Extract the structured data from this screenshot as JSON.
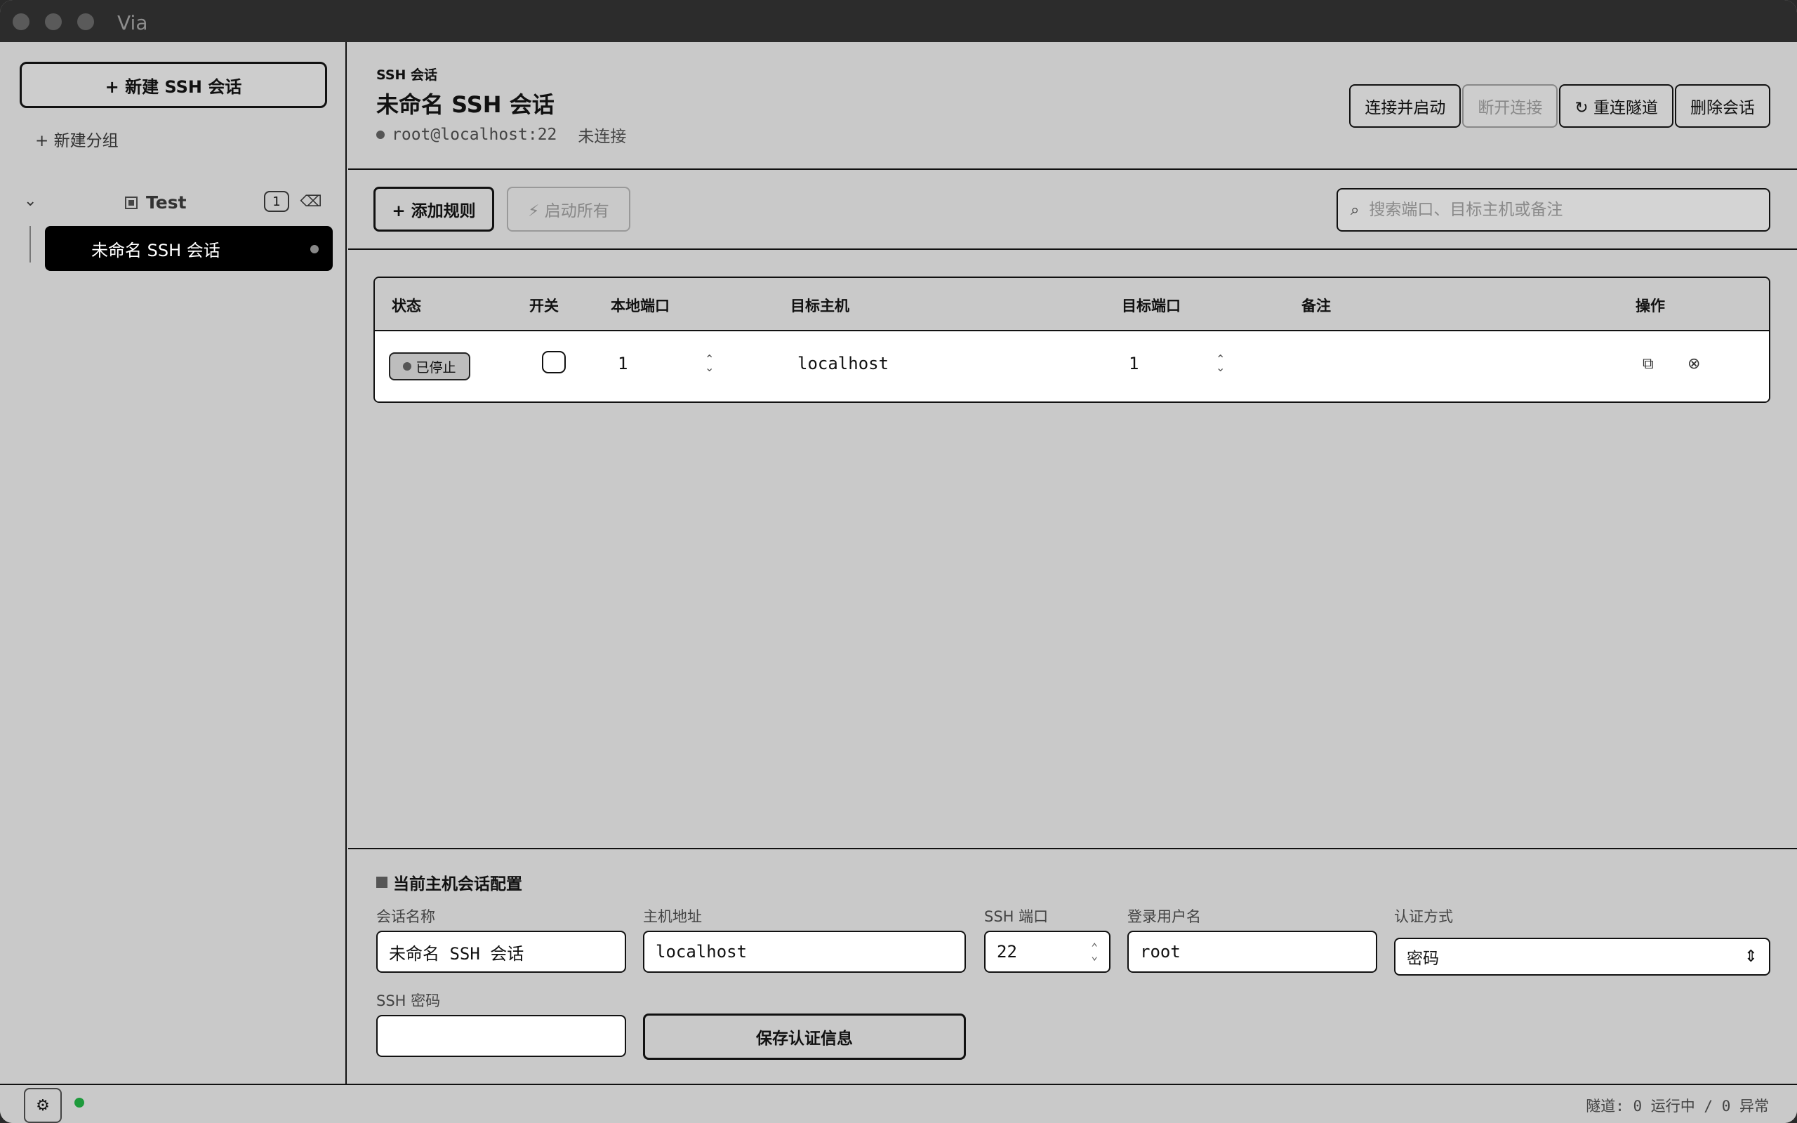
{
  "window": {
    "title": "Via"
  },
  "sidebar": {
    "new_session_label": "+ 新建 SSH 会话",
    "new_group_label": "+ 新建分组",
    "group": {
      "name": "Test",
      "count": "1"
    },
    "session": {
      "name": "未命名 SSH 会话"
    }
  },
  "header": {
    "kicker": "SSH 会话",
    "title": "未命名 SSH 会话",
    "target": "root@localhost:22",
    "connection_status": "未连接",
    "actions": {
      "connect": "连接并启动",
      "disconnect": "断开连接",
      "reconnect": "↻ 重连隧道",
      "delete": "删除会话"
    }
  },
  "toolbar": {
    "add_rule": "+ 添加规则",
    "start_all": "⚡ 启动所有",
    "search_placeholder": "搜索端口、目标主机或备注"
  },
  "rules": {
    "columns": [
      "状态",
      "开关",
      "本地端口",
      "目标主机",
      "目标端口",
      "备注",
      "操作"
    ],
    "rows": [
      {
        "status": "已停止",
        "enabled": false,
        "local_port": "1",
        "target_host": "localhost",
        "target_port": "1",
        "note": ""
      }
    ]
  },
  "config": {
    "title": "当前主机会话配置",
    "session_name_label": "会话名称",
    "session_name": "未命名 SSH 会话",
    "host_label": "主机地址",
    "host": "localhost",
    "port_label": "SSH 端口",
    "port": "22",
    "user_label": "登录用户名",
    "user": "root",
    "auth_label": "认证方式",
    "auth": "密码",
    "password_label": "SSH 密码",
    "password": "",
    "save_label": "保存认证信息"
  },
  "footer": {
    "stats": "隧道: 0 运行中 / 0 异常"
  }
}
